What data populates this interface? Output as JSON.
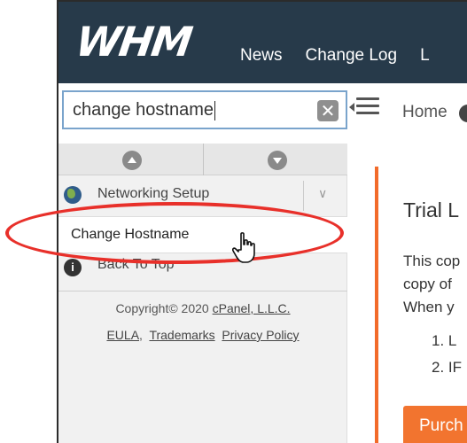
{
  "header": {
    "logo": "WHM",
    "nav": [
      "News",
      "Change Log",
      "L"
    ]
  },
  "search": {
    "value": "change hostname",
    "clear_icon": "clear-icon"
  },
  "breadcrumb": {
    "home": "Home"
  },
  "sidebar": {
    "items": [
      {
        "label": "Networking Setup",
        "icon": "globe-icon"
      },
      {
        "label": "Change Hostname"
      },
      {
        "label": "Back To Top",
        "icon": "info-icon"
      }
    ],
    "footer": {
      "copyright": "Copyright© 2020",
      "company": "cPanel, L.L.C.",
      "links": [
        "EULA",
        "Trademarks",
        "Privacy Policy"
      ]
    }
  },
  "main": {
    "title": "Trial L",
    "text_lines": [
      "This cop",
      "copy of",
      "When y"
    ],
    "list": [
      "1. L",
      "2. IF"
    ],
    "purchase_label": "Purch"
  },
  "colors": {
    "header_bg": "#273a4a",
    "accent_orange": "#f26b2a",
    "highlight_red": "#e8302a"
  }
}
